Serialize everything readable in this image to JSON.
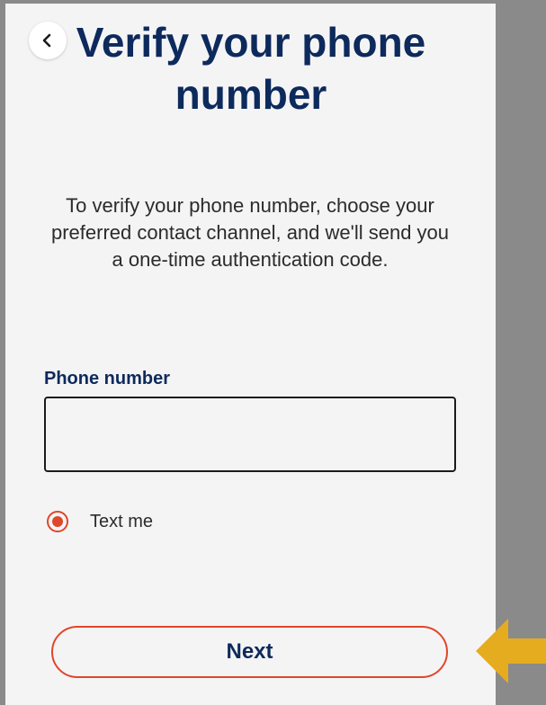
{
  "header": {
    "back_icon": "chevron-left-icon",
    "title": "Verify your phone number"
  },
  "instructions": "To verify your phone number, choose your preferred contact channel, and we'll send you a one-time authentication code.",
  "phone_field": {
    "label": "Phone number",
    "value": "",
    "placeholder": ""
  },
  "contact_channel": {
    "selected": true,
    "label": "Text me"
  },
  "next_button": {
    "label": "Next"
  },
  "pointer_arrow_icon": "arrow-left-icon",
  "colors": {
    "title": "#0d2a5c",
    "accent": "#e0462a",
    "background": "#f5f4f5",
    "arrow": "#e6ac1f",
    "backdrop": "#8a8a8a"
  }
}
